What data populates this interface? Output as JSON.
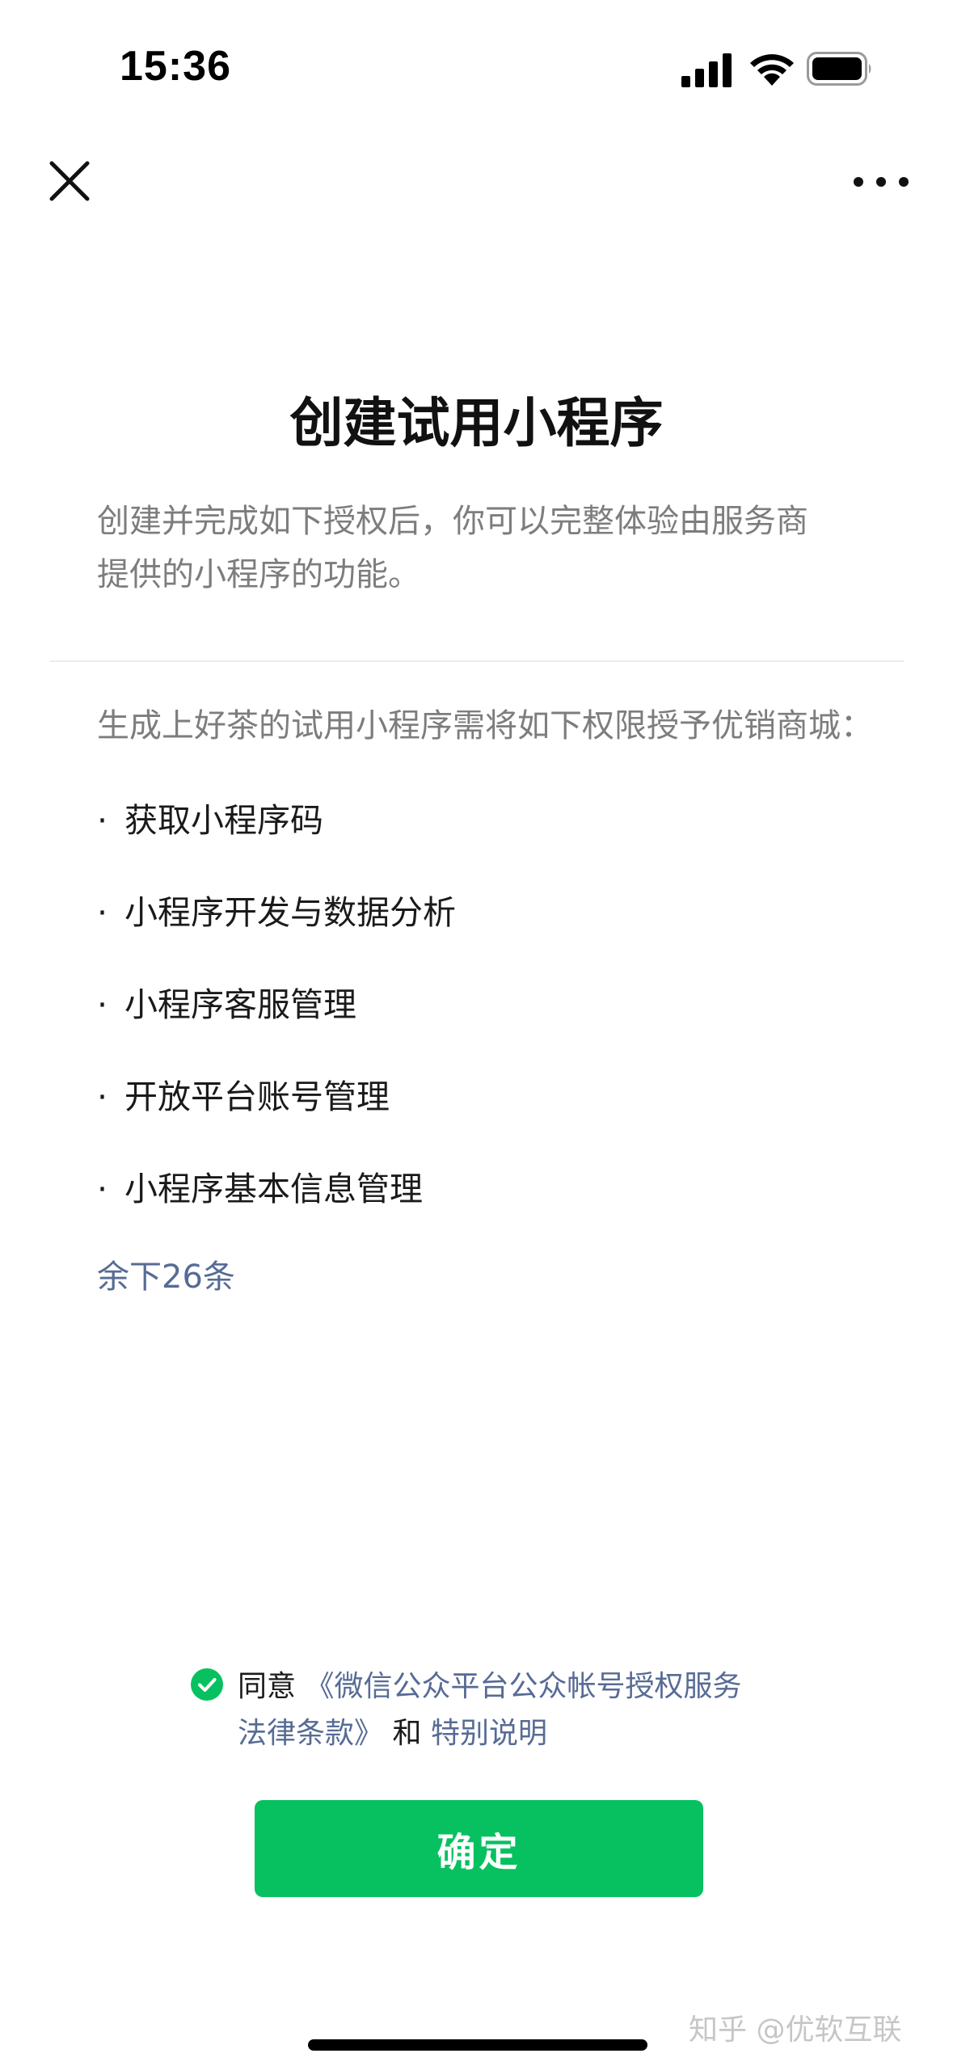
{
  "status_bar": {
    "time": "15:36",
    "icons": [
      "signal-icon",
      "wifi-icon",
      "battery-icon"
    ]
  },
  "nav": {
    "close_icon": "close-icon",
    "more_icon": "more-icon"
  },
  "page": {
    "title": "创建试用小程序",
    "intro_line1": "创建并完成如下授权后，你可以完整体验由服务商",
    "intro_line2": "提供的小程序的功能。"
  },
  "permissions": {
    "intro": "生成上好茶的试用小程序需将如下权限授予优销商城：",
    "bullet": "·",
    "items": [
      "获取小程序码",
      "小程序开发与数据分析",
      "小程序客服管理",
      "开放平台账号管理",
      "小程序基本信息管理"
    ],
    "more_label": "余下26条"
  },
  "agreement": {
    "checked": true,
    "prefix": "同意",
    "link1_line1": "《微信公众平台公众帐号授权服务",
    "link1_line2": "法律条款》",
    "joiner": "和",
    "link2": "特别说明"
  },
  "actions": {
    "confirm_label": "确定"
  },
  "watermark": "知乎 @优软互联",
  "colors": {
    "primary_green": "#07c160",
    "link_blue": "#576b95",
    "secondary_text": "#7d7d7d"
  }
}
